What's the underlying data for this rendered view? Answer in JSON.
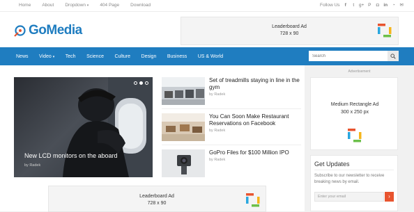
{
  "topbar": {
    "links": [
      "Home",
      "About",
      "Dropdown",
      "404 Page",
      "Download"
    ],
    "follow_label": "Follow Us",
    "social_icons": [
      "facebook-icon",
      "twitter-icon",
      "google-plus-icon",
      "pinterest-icon",
      "instagram-icon",
      "linkedin-icon",
      "rss-icon",
      "email-icon"
    ]
  },
  "header": {
    "logo_text": "GoMedia",
    "ad_line1": "Leaderboard Ad",
    "ad_line2": "728 x 90"
  },
  "nav": {
    "items": [
      "News",
      "Video",
      "Tech",
      "Science",
      "Culture",
      "Design",
      "Business",
      "US & World"
    ],
    "search_placeholder": "Search"
  },
  "feature": {
    "title": "New LCD monitors on the aboard",
    "author": "by Radek"
  },
  "posts": [
    {
      "title": "Set of treadmills staying in line in the gym",
      "author": "by Radek"
    },
    {
      "title": "You Can Soon Make Restaurant Reservations on Facebook",
      "author": "by Radek"
    },
    {
      "title": "GoPro Files for $100 Million IPO",
      "author": "by Radek"
    }
  ],
  "bottom_ad": {
    "line1": "Leaderboard Ad",
    "line2": "728 x 90"
  },
  "sidebar": {
    "advert_label": "Advertisement",
    "ad_line1": "Medium Rectangle Ad",
    "ad_line2": "300 x 250 px",
    "updates_title": "Get Updates",
    "updates_text": "Subscribe to our newsletter to receive breaking news by email.",
    "email_placeholder": "Enter your email",
    "submit_symbol": "›"
  },
  "colors": {
    "brand_blue": "#1f7dc0",
    "accent_orange": "#e8542f"
  }
}
